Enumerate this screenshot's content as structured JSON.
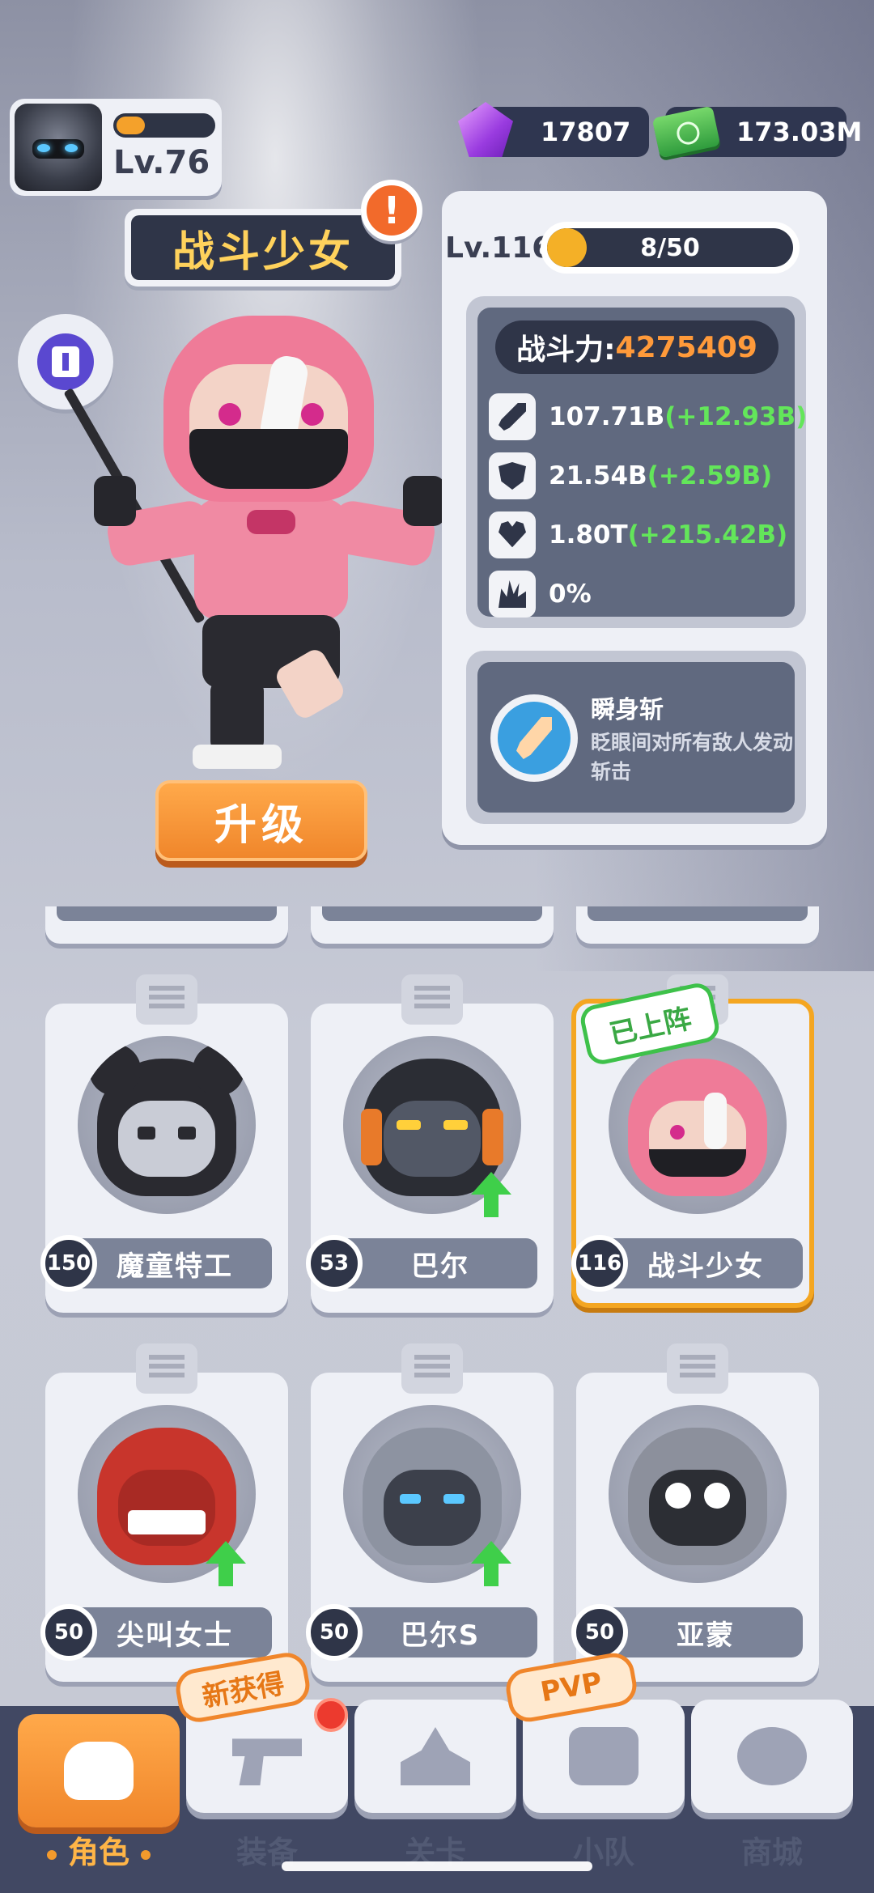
{
  "player": {
    "level": "Lv.76",
    "xp_fraction": 0.3
  },
  "currency": {
    "gems": "17807",
    "cash": "173.03M"
  },
  "hero": {
    "name": "战斗少女",
    "alert": "!",
    "upgrade_label": "升级",
    "level": "Lv.116",
    "progress": "8/50",
    "power_label": "战斗力:",
    "power_value": "4275409",
    "stats": [
      {
        "icon": "sword-icon",
        "value": "107.71B",
        "bonus": "(+12.93B)"
      },
      {
        "icon": "shield-icon",
        "value": "21.54B",
        "bonus": "(+2.59B)"
      },
      {
        "icon": "heart-icon",
        "value": "1.80T",
        "bonus": "(+215.42B)"
      },
      {
        "icon": "burst-icon",
        "value": "0%",
        "bonus": ""
      }
    ],
    "skill": {
      "name": "瞬身斩",
      "desc": "眨眼间对所有敌人发动斩击"
    }
  },
  "characters": [
    {
      "name": "魔童特工",
      "level": "150",
      "upgrade": false,
      "selected": false,
      "theme": "skull"
    },
    {
      "name": "巴尔",
      "level": "53",
      "upgrade": true,
      "selected": false,
      "theme": "robot"
    },
    {
      "name": "战斗少女",
      "level": "116",
      "upgrade": false,
      "selected": true,
      "tag": "已上阵",
      "theme": "ninja"
    },
    {
      "name": "尖叫女士",
      "level": "50",
      "upgrade": true,
      "selected": false,
      "theme": "red"
    },
    {
      "name": "巴尔S",
      "level": "50",
      "upgrade": true,
      "selected": false,
      "theme": "robot-silver"
    },
    {
      "name": "亚蒙",
      "level": "50",
      "upgrade": false,
      "selected": false,
      "theme": "hood"
    }
  ],
  "nav": {
    "items": [
      {
        "label": "角色",
        "icon": "skull-icon",
        "active": true
      },
      {
        "label": "装备",
        "icon": "gun-icon",
        "active": false
      },
      {
        "label": "关卡",
        "icon": "map-pin-icon",
        "active": false
      },
      {
        "label": "小队",
        "icon": "team-icon",
        "active": false
      },
      {
        "label": "商城",
        "icon": "shop-icon",
        "active": false
      }
    ],
    "badge_new": "新获得",
    "badge_pvp": "PVP"
  },
  "colors": {
    "accent": "#f0862b",
    "bonus_green": "#63e65a",
    "power_orange": "#ff9a3a",
    "name_gold": "#ffd25c"
  }
}
